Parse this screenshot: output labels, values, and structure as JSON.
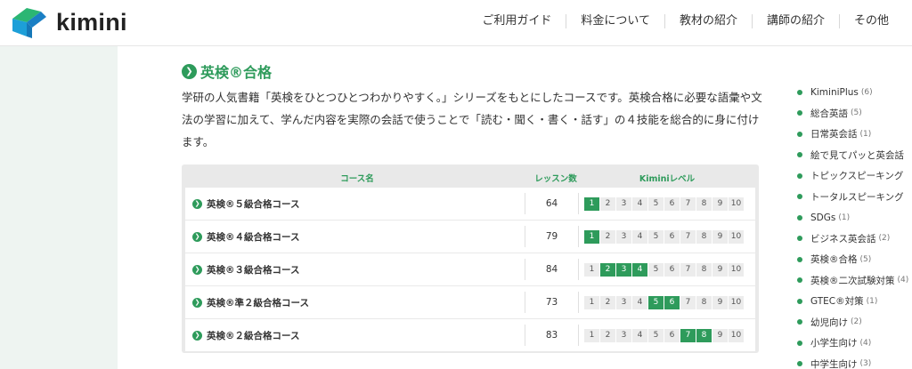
{
  "header": {
    "logo_text": "kimini",
    "nav": [
      "ご利用ガイド",
      "料金について",
      "教材の紹介",
      "講師の紹介",
      "その他"
    ]
  },
  "section": {
    "title": "英検®合格",
    "description": "学研の人気書籍「英検をひとつひとつわかりやすく。」シリーズをもとにしたコースです。英検合格に必要な語彙や文法の学習に加えて、学んだ内容を実際の会話で使うことで「読む・聞く・書く・話す」の４技能を総合的に身に付けます。"
  },
  "table": {
    "headers": {
      "name": "コース名",
      "lessons": "レッスン数",
      "level": "Kiminiレベル"
    },
    "levels": [
      "1",
      "2",
      "3",
      "4",
      "5",
      "6",
      "7",
      "8",
      "9",
      "10"
    ],
    "rows": [
      {
        "name": "英検®５級合格コース",
        "lessons": "64",
        "active_levels": [
          1
        ]
      },
      {
        "name": "英検®４級合格コース",
        "lessons": "79",
        "active_levels": [
          1
        ]
      },
      {
        "name": "英検®３級合格コース",
        "lessons": "84",
        "active_levels": [
          2,
          3,
          4
        ]
      },
      {
        "name": "英検®準２級合格コース",
        "lessons": "73",
        "active_levels": [
          5,
          6
        ]
      },
      {
        "name": "英検®２級合格コース",
        "lessons": "83",
        "active_levels": [
          7,
          8
        ]
      }
    ]
  },
  "sidebar": {
    "items": [
      {
        "label": "KiminiPlus",
        "count": "(6)"
      },
      {
        "label": "総合英語",
        "count": "(5)"
      },
      {
        "label": "日常英会話",
        "count": "(1)"
      },
      {
        "label": "絵で見てパッと英会話",
        "count": ""
      },
      {
        "label": "トピックスピーキング",
        "count": ""
      },
      {
        "label": "トータルスピーキング",
        "count": ""
      },
      {
        "label": "SDGs",
        "count": "(1)"
      },
      {
        "label": "ビジネス英会話",
        "count": "(2)"
      },
      {
        "label": "英検®合格",
        "count": "(5)"
      },
      {
        "label": "英検®二次試験対策",
        "count": "(4)"
      },
      {
        "label": "GTEC®対策",
        "count": "(1)"
      },
      {
        "label": "幼児向け",
        "count": "(2)"
      },
      {
        "label": "小学生向け",
        "count": "(4)"
      },
      {
        "label": "中学生向け",
        "count": "(3)"
      }
    ]
  },
  "colors": {
    "accent": "#2e9b5b"
  }
}
